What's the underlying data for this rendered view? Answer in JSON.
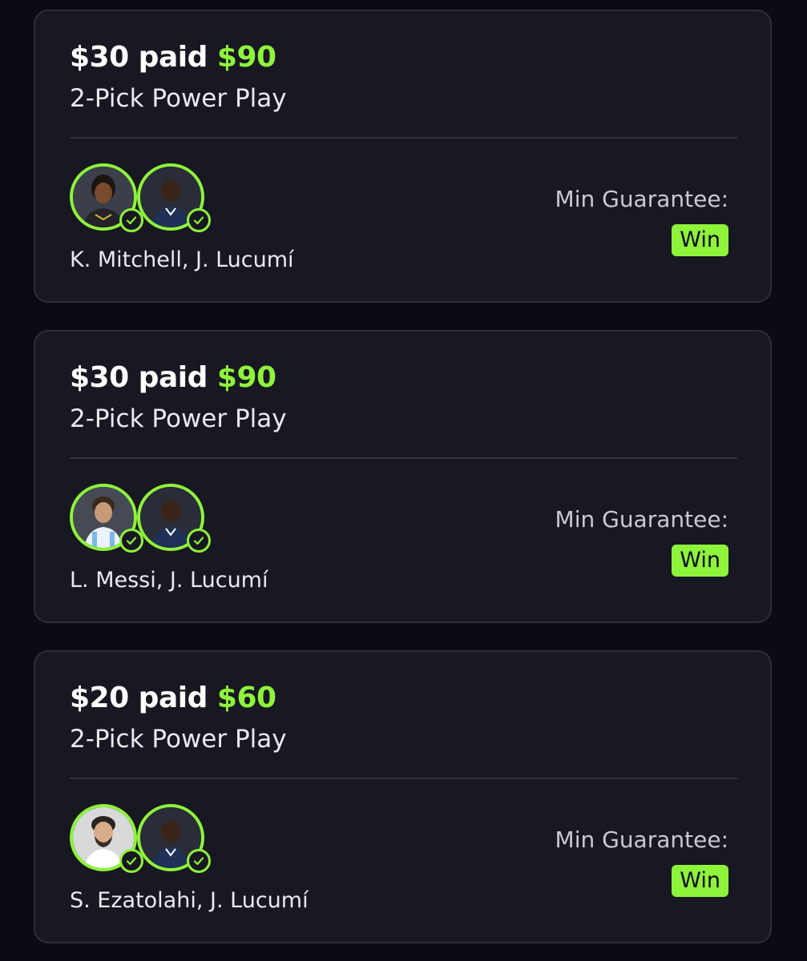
{
  "entries": [
    {
      "paid_text": "$30 paid",
      "payout": "$90",
      "play_type": "2-Pick Power Play",
      "players_text": "K. Mitchell, J. Lucumí",
      "guarantee_label": "Min Guarantee:",
      "result_badge": "Win"
    },
    {
      "paid_text": "$30 paid",
      "payout": "$90",
      "play_type": "2-Pick Power Play",
      "players_text": "L. Messi, J. Lucumí",
      "guarantee_label": "Min Guarantee:",
      "result_badge": "Win"
    },
    {
      "paid_text": "$20 paid",
      "payout": "$60",
      "play_type": "2-Pick Power Play",
      "players_text": "S. Ezatolahi, J. Lucumí",
      "guarantee_label": "Min Guarantee:",
      "result_badge": "Win"
    }
  ],
  "colors": {
    "accent": "#8ef33b",
    "card_bg": "#181822",
    "page_bg": "#0b0b14"
  },
  "icons": {
    "pick_status": "check-circle-icon"
  }
}
